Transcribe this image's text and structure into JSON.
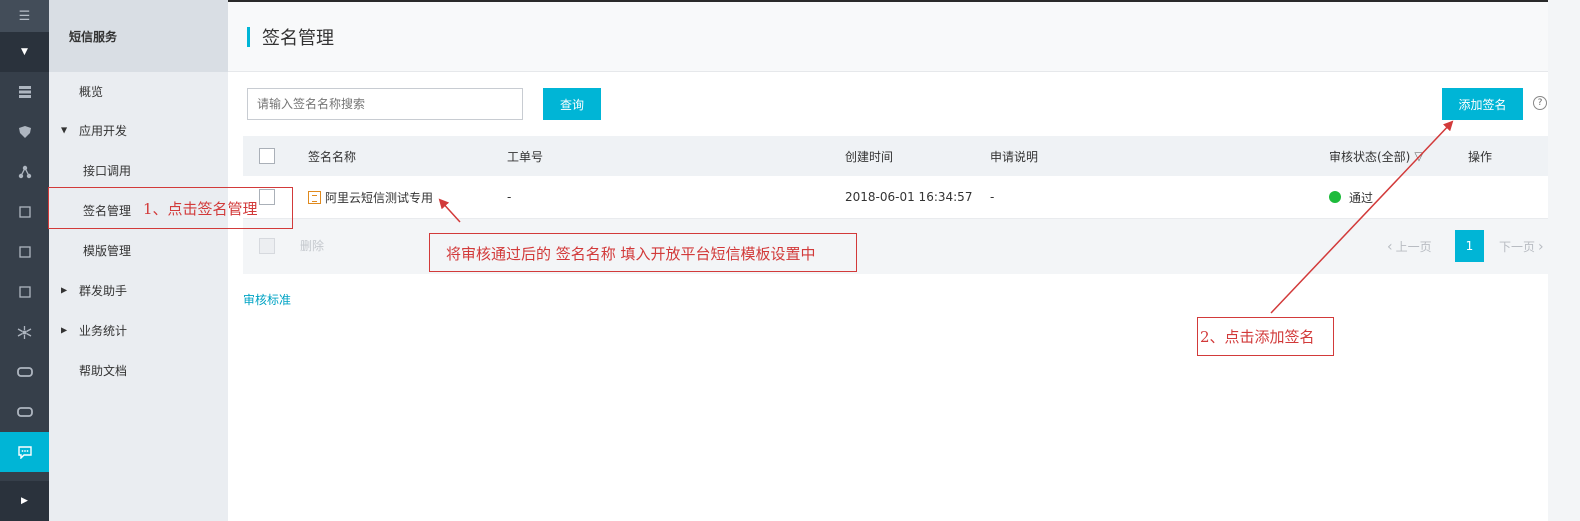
{
  "rail": {
    "icons": [
      "menu-icon",
      "chevron-down-icon",
      "database-icon",
      "shield-icon",
      "cluster-icon",
      "square-icon",
      "square-icon",
      "square-icon",
      "network-icon",
      "link-icon",
      "link-icon",
      "message-icon",
      "chevron-right-icon"
    ]
  },
  "sidebar": {
    "title": "短信服务",
    "items": [
      {
        "label": "概览"
      },
      {
        "label": "应用开发"
      },
      {
        "label": "接口调用"
      },
      {
        "label": "签名管理"
      },
      {
        "label": "模版管理"
      },
      {
        "label": "群发助手"
      },
      {
        "label": "业务统计"
      },
      {
        "label": "帮助文档"
      }
    ]
  },
  "page": {
    "title": "签名管理",
    "search_placeholder": "请输入签名名称搜索",
    "query_label": "查询",
    "add_label": "添加签名",
    "help_label": "?"
  },
  "table": {
    "headers": [
      "签名名称",
      "工单号",
      "创建时间",
      "申请说明",
      "审核状态(全部)",
      "操作"
    ],
    "rows": [
      {
        "name": "阿里云短信测试专用",
        "ticket": "-",
        "created": "2018-06-01 16:34:57",
        "note": "-",
        "status": "通过",
        "status_color": "#1dbb3b"
      }
    ],
    "delete_label": "删除",
    "pager": {
      "prev": "上一页",
      "current": "1",
      "next": "下一页"
    }
  },
  "standard_link": "审核标准",
  "annotations": {
    "step1": "1、点击签名管理",
    "note": "将审核通过后的 签名名称 填入开放平台短信模板设置中",
    "step2": "2、点击添加签名",
    "color": "#d23a3a"
  },
  "colors": {
    "accent": "#00b5d6",
    "rail": "#363f4a",
    "sidebar": "#eaedf1"
  }
}
